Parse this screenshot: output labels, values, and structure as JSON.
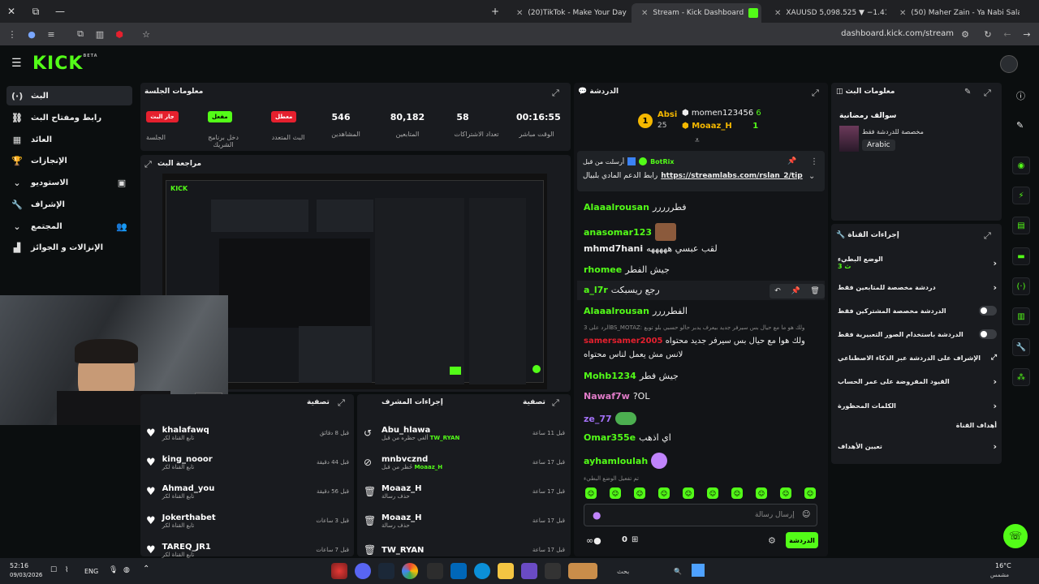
{
  "browser": {
    "tabs": [
      {
        "label": "(20)TikTok - Make Your Day",
        "color": "#ff2d55"
      },
      {
        "label": "Stream - Kick Dashboard",
        "color": "#53fc18"
      },
      {
        "label": "XAUUSD 5,098.525 ▼ −1.41% U",
        "color": "#2962ff"
      },
      {
        "label": "(50) Maher Zain - Ya Nabi Salam",
        "color": "#ff0000"
      }
    ],
    "url": "dashboard.kick.com/stream"
  },
  "kick": {
    "logo": "KICK",
    "beta": "BETA"
  },
  "nav": [
    {
      "label": "البث",
      "icon": "(·)"
    },
    {
      "label": "رابط ومفتاح البث",
      "icon": "⛓"
    },
    {
      "label": "العائد",
      "icon": "▦"
    },
    {
      "label": "الإنجازات",
      "icon": "🏆"
    },
    {
      "label": "الاستوديو",
      "icon": "▣"
    },
    {
      "label": "الإشراف",
      "icon": "🔧"
    },
    {
      "label": "المجتمع",
      "icon": "👥"
    },
    {
      "label": "الإنزالات و الجوائز",
      "icon": "▟"
    }
  ],
  "session": {
    "title": "معلومات الجلسة",
    "badges": [
      {
        "badge": "جار البث",
        "label": "الجلسة",
        "color": "#e5202e"
      },
      {
        "badge": "مفعل",
        "label": "دخل برنامج الشريك",
        "color": "#53fc18"
      },
      {
        "badge": "معطل",
        "label": "البث المتعدد",
        "color": "#e5202e"
      }
    ],
    "stats": [
      {
        "value": "546",
        "label": "المشاهدين"
      },
      {
        "value": "80,182",
        "label": "المتابعين"
      },
      {
        "value": "58",
        "label": "تعداد الاشتراكات"
      },
      {
        "value": "00:16:55",
        "label": "الوقت مباشر"
      }
    ]
  },
  "preview": {
    "title": "مراجعة البث"
  },
  "activity": {
    "title": "تصفية",
    "items": [
      {
        "name": "khalafawq",
        "sub": "تابع القناة لكر",
        "time": "قبل 8 دقائق"
      },
      {
        "name": "king_nooor",
        "sub": "تابع القناة لكر",
        "time": "قبل 44 دقيقة"
      },
      {
        "name": "Ahmad_you",
        "sub": "تابع القناة لكر",
        "time": "قبل 56 دقيقة"
      },
      {
        "name": "Jokerthabet",
        "sub": "تابع القناة لكر",
        "time": "قبل 3 ساعات"
      },
      {
        "name": "TAREQ_JR1",
        "sub": "تابع القناة لكر",
        "time": "قبل 7 ساعات"
      }
    ]
  },
  "modactions": {
    "title": "إجراءات المشرف",
    "filter": "تصفية",
    "items": [
      {
        "name": "Abu_hlawa",
        "sub": "ألغي حظره من قبل",
        "by": "TW_RYAN",
        "time": "قبل 11 ساعة",
        "icon": "↺"
      },
      {
        "name": "mnbvcznd",
        "sub": "حُظر من قبل",
        "by": "Moaaz_H",
        "time": "قبل 17 ساعة",
        "icon": "⊘"
      },
      {
        "name": "Moaaz_H",
        "sub": "حذف رسالة",
        "by": "",
        "time": "قبل 17 ساعة",
        "icon": "🗑"
      },
      {
        "name": "Moaaz_H",
        "sub": "حذف رسالة",
        "by": "",
        "time": "قبل 17 ساعة",
        "icon": "🗑"
      },
      {
        "name": "TW_RYAN",
        "sub": "",
        "by": "",
        "time": "قبل 17 ساعة",
        "icon": "🗑"
      }
    ]
  },
  "chat": {
    "title": "الدردشة",
    "leaders": [
      {
        "name": "Absi",
        "value": "25"
      },
      {
        "name": "momen123456",
        "value": "6"
      },
      {
        "name": "Moaaz_H",
        "value": "1"
      }
    ],
    "pinned": {
      "by_label": "أرسلت من قبل",
      "by": "BotRix",
      "text": "رابط الدعم المادي بلبيال",
      "link": "https://streamlabs.com/rslan_2/tip"
    },
    "messages": [
      {
        "user": "Alaaalrousan",
        "text": "فطررررر",
        "color": "#53fc18"
      },
      {
        "user": "anasomar123",
        "text": "",
        "color": "#53fc18"
      },
      {
        "user": "mhmd7hani",
        "text": "لقب عبسي هههههه",
        "color": "#eee"
      },
      {
        "user": "rhomee",
        "text": "جيش الفطر",
        "color": "#53fc18"
      },
      {
        "user": "a_l7r",
        "text": "رجع ريسبكت",
        "color": "#53fc18"
      },
      {
        "user": "Alaaalrousan",
        "text": "الفطرررر",
        "color": "#53fc18"
      },
      {
        "user": "samersamer2005",
        "text": "ولك هوا مع حيال بس سيرفر جديد محتواه لانس مش يعمل لناس محتواه",
        "color": "#e5202e"
      },
      {
        "user": "Mohb1234",
        "text": "جيش فطر",
        "color": "#53fc18"
      },
      {
        "user": "Nawaf7w",
        "text": "?OL",
        "color": "#e07bc8"
      },
      {
        "user": "ze_77",
        "text": "",
        "color": "#a371f7"
      },
      {
        "user": "Omar355e",
        "text": "اي اذهب",
        "color": "#53fc18"
      },
      {
        "user": "ayhamloulah",
        "text": "",
        "color": "#53fc18"
      }
    ],
    "reply_hint": "الرد على 3BS_MOTAZ: ولك هو ما مع حيال بس سيرفر جديد بيعرف يدبر حالو حسبي بلو توبع",
    "emote_mode": "تم تفعيل الوضع البطيء",
    "placeholder": "إرسال رسالة",
    "send": "الدردشة",
    "points": "0"
  },
  "streaminfo": {
    "title": "معلومات البث",
    "stream_title": "سوالف رمضانية",
    "category": "مخصصة للدردشة فقط",
    "language": "Arabic"
  },
  "channelactions": {
    "title": "إجراءات القناة",
    "slowmode": "الوضع البطيء",
    "slowmode_val": "3 ث",
    "items": [
      {
        "label": "دردشة مخصصة للمتابعين فقط",
        "ctl": "chevron"
      },
      {
        "label": "الدردشة مخصصة المشتركين فقط",
        "ctl": "toggle"
      },
      {
        "label": "الدردشة باستخدام الصور التعبيرية فقط",
        "ctl": "toggle"
      },
      {
        "label": "الإشراف على الدردشة عبر الذكاء الاصطناعي",
        "ctl": "ext"
      },
      {
        "label": "القيود المفروضة على عمر الحساب",
        "ctl": "chevron"
      },
      {
        "label": "الكلمات المحظورة",
        "ctl": "chevron"
      }
    ],
    "goals_header": "أهداف القناة",
    "goals": "تعيين الأهداف"
  },
  "taskbar": {
    "time": "52:16",
    "date": "09/03/2026",
    "lang": "ENG",
    "search": "بحث",
    "weather": "16°C",
    "weather_sub": "مشمس"
  }
}
